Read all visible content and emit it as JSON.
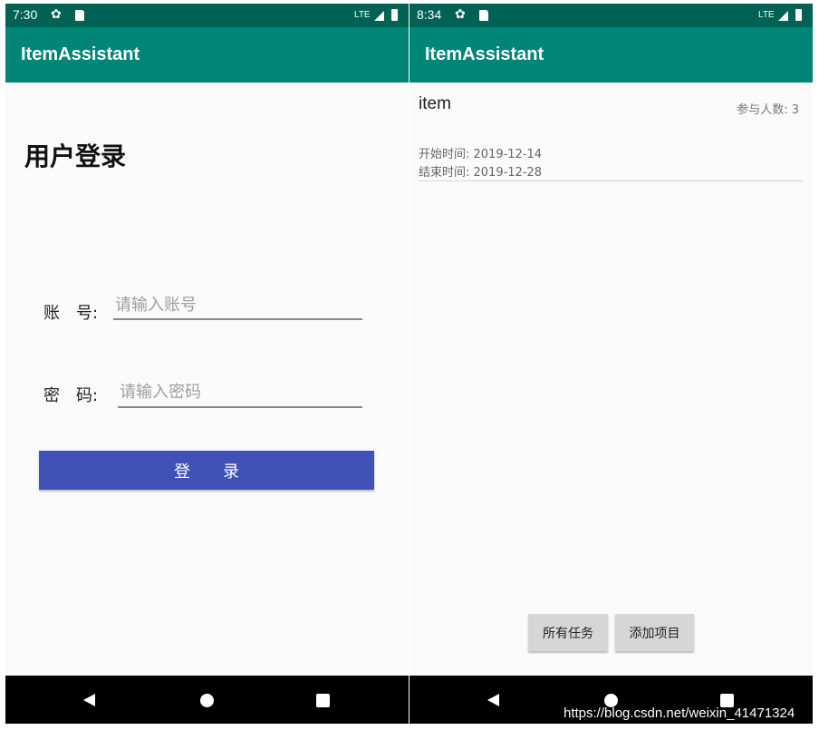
{
  "left_screen": {
    "status": {
      "time": "7:30",
      "network": "LTE"
    },
    "app_bar": {
      "title": "ItemAssistant"
    },
    "login": {
      "title": "用户登录",
      "account_label": "账　号:",
      "account_placeholder": "请输入账号",
      "password_label": "密　码:",
      "password_placeholder": "请输入密码",
      "submit_label": "登录"
    }
  },
  "right_screen": {
    "status": {
      "time": "8:34",
      "network": "LTE"
    },
    "app_bar": {
      "title": "ItemAssistant"
    },
    "items": [
      {
        "name": "item",
        "participants": "参与人数: 3",
        "start": "开始时间: 2019-12-14",
        "end": "结束时间: 2019-12-28"
      }
    ],
    "actions": {
      "all_tasks": "所有任务",
      "add_item": "添加项目"
    }
  },
  "watermark": "https://blog.csdn.net/weixin_41471324",
  "colors": {
    "status_bar": "#006155",
    "app_bar": "#008577",
    "login_button": "#3f51b5",
    "action_button": "#d6d6d6"
  },
  "icons": {
    "status": [
      "gear-icon",
      "sd-card-icon",
      "signal-icon",
      "battery-icon"
    ],
    "nav": [
      "back-icon",
      "home-icon",
      "recent-apps-icon"
    ]
  }
}
